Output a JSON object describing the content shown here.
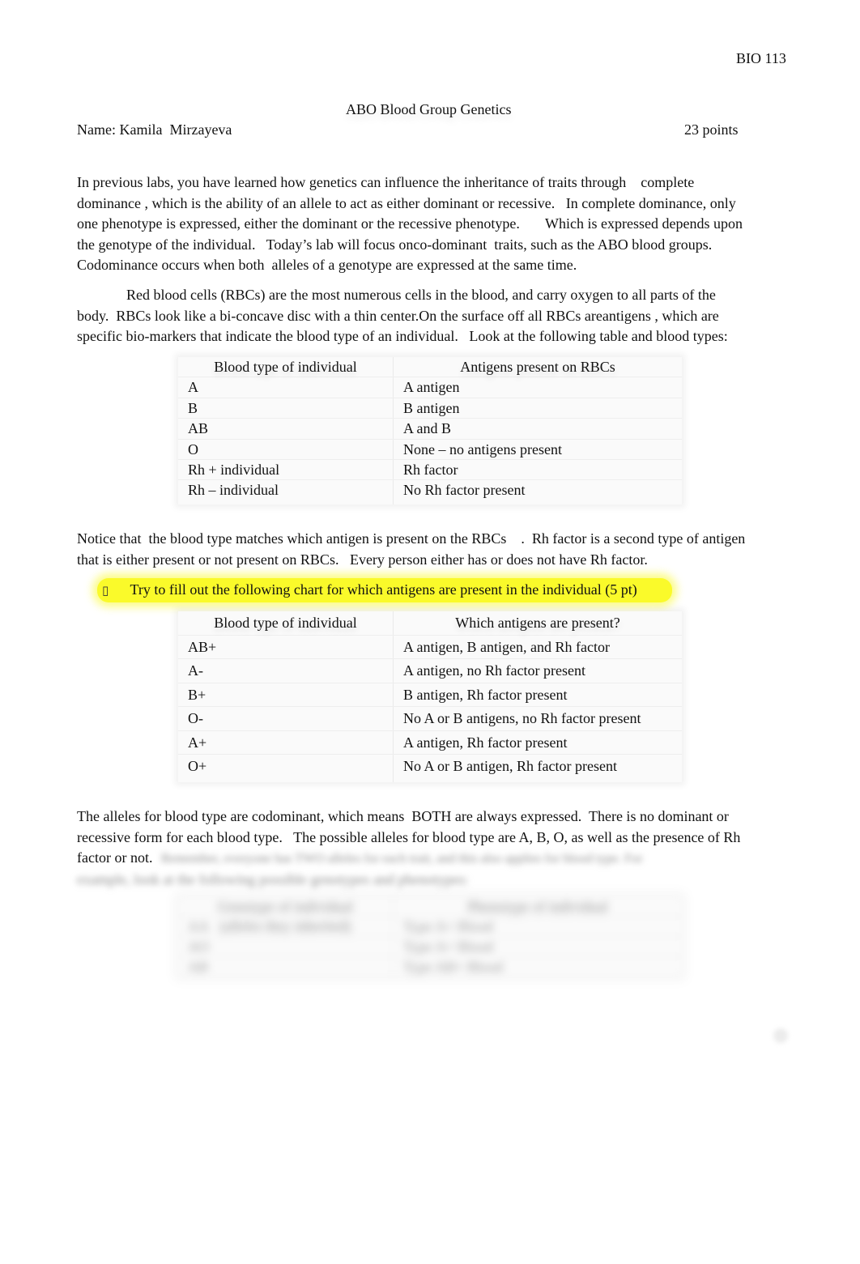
{
  "header": {
    "course": "BIO 113",
    "title": "ABO Blood Group Genetics",
    "name_label": "Name:",
    "name_value": "Kamila  Mirzayeva",
    "points": "23 points"
  },
  "paragraphs": {
    "intro": [
      "In previous labs, you have learned how genetics can influence the inheritance of traits through    complete",
      "dominance , which is the ability of an allele to act as either dominant or recessive.   In complete dominance, only",
      "one phenotype is expressed, either the dominant or the recessive phenotype.       Which is expressed depends upon",
      "the genotype of the individual.   Today’s lab will focus onco-dominant  traits, such as the ABO blood groups.",
      "Codominance occurs when both  alleles of a genotype are expressed at the same time."
    ],
    "rbc": [
      "Red blood cells (RBCs) are the most numerous cells in the blood, and carry oxygen to all parts of the",
      "body.  RBCs look like a bi-concave disc with a thin center.On the surface off all RBCs areantigens , which are",
      "specific bio-markers that indicate the blood type of an individual.   Look at the following table and blood types:"
    ],
    "notice": [
      "Notice that  the blood type matches which antigen is present on the RBCs    .  Rh factor is a second type of antigen",
      "that is either present or not present on RBCs.   Every person either has or does not have Rh factor."
    ],
    "alleles": [
      "The alleles for blood type are codominant, which means  BOTH are always expressed.  There is no dominant or",
      "recessive form for each blood type.   The possible alleles for blood type are A, B, O, as well as the presence of Rh",
      "factor or not."
    ],
    "alleles_blurred": [
      "Remember, everyone has TWO alleles for each trait, and this also applies for blood type.   For",
      "example, look at the following possible genotypes and phenotypes:"
    ]
  },
  "instruction": {
    "bullet_icon": "",
    "text": "Try to fill out the following chart for which antigens are present in the individual (5 pt)",
    "highlight_color": "#fafa2a"
  },
  "table_antigens": {
    "headers": [
      "Blood type of individual",
      "Antigens present on RBCs"
    ],
    "rows": [
      [
        "A",
        "A antigen"
      ],
      [
        "B",
        "B antigen"
      ],
      [
        "AB",
        "A and B"
      ],
      [
        "O",
        "None – no antigens present"
      ],
      [
        "Rh + individual",
        "Rh factor"
      ],
      [
        "Rh – individual",
        "No Rh factor present"
      ]
    ]
  },
  "table_fill": {
    "headers": [
      "Blood type of individual",
      "Which antigens are present?"
    ],
    "rows": [
      [
        "AB+",
        "A antigen, B antigen, and Rh factor"
      ],
      [
        "A-",
        "A antigen, no Rh factor present"
      ],
      [
        "B+",
        "B antigen, Rh factor present"
      ],
      [
        "O-",
        "No A or B antigens, no Rh factor present"
      ],
      [
        "A+",
        "A antigen, Rh factor present"
      ],
      [
        "O+",
        "No A or B antigen, Rh factor present"
      ]
    ]
  },
  "table_genotypes_blurred": {
    "headers": [
      "Genotype of individual (alleles they inherited)",
      "Phenotype of individual"
    ],
    "rows": [
      [
        "AA",
        "Type A+ Blood"
      ],
      [
        "AO",
        "Type A+ Blood"
      ],
      [
        "AB",
        "Type AB+ Blood"
      ]
    ]
  },
  "footer": {
    "page_number": "1"
  }
}
